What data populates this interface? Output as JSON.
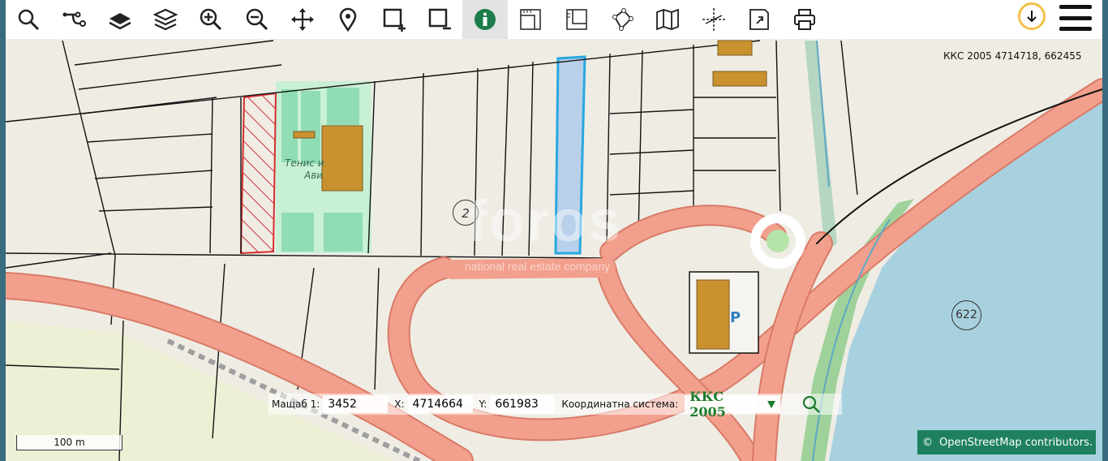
{
  "toolbar": {
    "tools": [
      {
        "name": "search-icon",
        "label": "Search"
      },
      {
        "name": "route-icon",
        "label": "Route"
      },
      {
        "name": "layer-icon",
        "label": "Layer"
      },
      {
        "name": "layers-icon",
        "label": "Layers"
      },
      {
        "name": "zoom-in-icon",
        "label": "Zoom in"
      },
      {
        "name": "zoom-out-icon",
        "label": "Zoom out"
      },
      {
        "name": "pan-icon",
        "label": "Pan"
      },
      {
        "name": "location-pin-icon",
        "label": "Location"
      },
      {
        "name": "rect-add-icon",
        "label": "Add selection"
      },
      {
        "name": "rect-remove-icon",
        "label": "Remove selection"
      },
      {
        "name": "info-icon",
        "label": "Info",
        "active": true
      },
      {
        "name": "measure-icon",
        "label": "Measure"
      },
      {
        "name": "measure-area-icon",
        "label": "Measure area"
      },
      {
        "name": "polygon-icon",
        "label": "Polygon"
      },
      {
        "name": "map-icon",
        "label": "Map"
      },
      {
        "name": "crosshair-icon",
        "label": "Crosshair"
      },
      {
        "name": "export-icon",
        "label": "Export"
      },
      {
        "name": "print-icon",
        "label": "Print"
      }
    ],
    "download_icon": "download-icon",
    "menu_icon": "hamburger-menu-icon"
  },
  "coords_top": "ККС 2005 4714718, 662455",
  "bottom": {
    "scale_label": "Мащаб 1:",
    "scale_value": "3452",
    "x_label": "X:",
    "x_value": "4714664",
    "y_label": "Y:",
    "y_value": "661983",
    "crs_label": "Координатна система:",
    "crs_value": "ККС 2005"
  },
  "scale_bar": "100 m",
  "attribution": {
    "symbol": "©",
    "text": "OpenStreetMap  contributors."
  },
  "map_labels": {
    "tennis": "Тенис и",
    "tennis2": "Ави",
    "plot_2": "2",
    "road_622": "622",
    "parking": "P",
    "watermark": "foros",
    "watermark_sub": "national real estate company"
  },
  "colors": {
    "road": "#f2a08d",
    "road_stroke": "#d97a66",
    "water": "#a8d1df",
    "building": "#c9922f",
    "park": "#8fdcb5",
    "selected_parcel": "#b8d0ea",
    "hatch": "#d32f2f",
    "accent_green": "#1b7d2d",
    "attrib_bg": "#1e8060"
  }
}
